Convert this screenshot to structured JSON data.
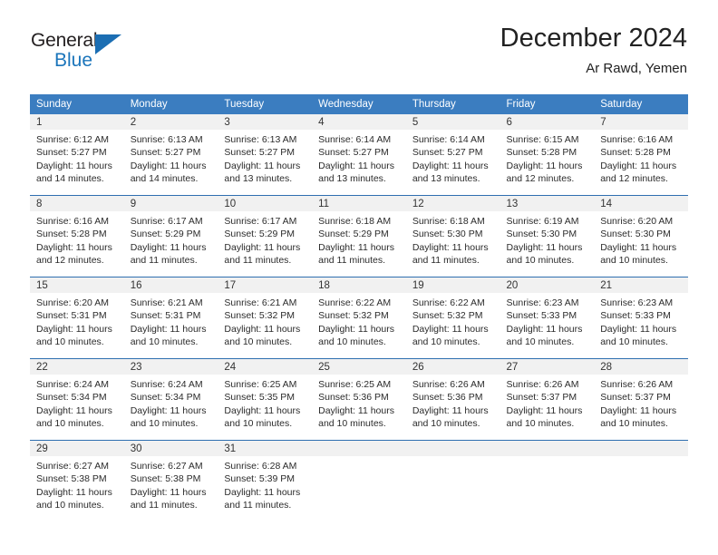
{
  "brand": {
    "name_part1": "General",
    "name_part2": "Blue",
    "flag_icon": "triangle-flag-icon"
  },
  "header": {
    "title": "December 2024",
    "subtitle": "Ar Rawd, Yemen"
  },
  "colors": {
    "header_blue": "#3b7dc0",
    "separator_blue": "#2f6fb0",
    "daynum_band": "#f1f1f1",
    "brand_blue": "#1b75bb",
    "text": "#2b2b2b"
  },
  "weekday_headers": [
    "Sunday",
    "Monday",
    "Tuesday",
    "Wednesday",
    "Thursday",
    "Friday",
    "Saturday"
  ],
  "labels": {
    "sunrise_prefix": "Sunrise:",
    "sunset_prefix": "Sunset:",
    "daylight_prefix": "Daylight:"
  },
  "weeks": [
    [
      {
        "day": "1",
        "sunrise": "Sunrise: 6:12 AM",
        "sunset": "Sunset: 5:27 PM",
        "daylight1": "Daylight: 11 hours",
        "daylight2": "and 14 minutes."
      },
      {
        "day": "2",
        "sunrise": "Sunrise: 6:13 AM",
        "sunset": "Sunset: 5:27 PM",
        "daylight1": "Daylight: 11 hours",
        "daylight2": "and 14 minutes."
      },
      {
        "day": "3",
        "sunrise": "Sunrise: 6:13 AM",
        "sunset": "Sunset: 5:27 PM",
        "daylight1": "Daylight: 11 hours",
        "daylight2": "and 13 minutes."
      },
      {
        "day": "4",
        "sunrise": "Sunrise: 6:14 AM",
        "sunset": "Sunset: 5:27 PM",
        "daylight1": "Daylight: 11 hours",
        "daylight2": "and 13 minutes."
      },
      {
        "day": "5",
        "sunrise": "Sunrise: 6:14 AM",
        "sunset": "Sunset: 5:27 PM",
        "daylight1": "Daylight: 11 hours",
        "daylight2": "and 13 minutes."
      },
      {
        "day": "6",
        "sunrise": "Sunrise: 6:15 AM",
        "sunset": "Sunset: 5:28 PM",
        "daylight1": "Daylight: 11 hours",
        "daylight2": "and 12 minutes."
      },
      {
        "day": "7",
        "sunrise": "Sunrise: 6:16 AM",
        "sunset": "Sunset: 5:28 PM",
        "daylight1": "Daylight: 11 hours",
        "daylight2": "and 12 minutes."
      }
    ],
    [
      {
        "day": "8",
        "sunrise": "Sunrise: 6:16 AM",
        "sunset": "Sunset: 5:28 PM",
        "daylight1": "Daylight: 11 hours",
        "daylight2": "and 12 minutes."
      },
      {
        "day": "9",
        "sunrise": "Sunrise: 6:17 AM",
        "sunset": "Sunset: 5:29 PM",
        "daylight1": "Daylight: 11 hours",
        "daylight2": "and 11 minutes."
      },
      {
        "day": "10",
        "sunrise": "Sunrise: 6:17 AM",
        "sunset": "Sunset: 5:29 PM",
        "daylight1": "Daylight: 11 hours",
        "daylight2": "and 11 minutes."
      },
      {
        "day": "11",
        "sunrise": "Sunrise: 6:18 AM",
        "sunset": "Sunset: 5:29 PM",
        "daylight1": "Daylight: 11 hours",
        "daylight2": "and 11 minutes."
      },
      {
        "day": "12",
        "sunrise": "Sunrise: 6:18 AM",
        "sunset": "Sunset: 5:30 PM",
        "daylight1": "Daylight: 11 hours",
        "daylight2": "and 11 minutes."
      },
      {
        "day": "13",
        "sunrise": "Sunrise: 6:19 AM",
        "sunset": "Sunset: 5:30 PM",
        "daylight1": "Daylight: 11 hours",
        "daylight2": "and 10 minutes."
      },
      {
        "day": "14",
        "sunrise": "Sunrise: 6:20 AM",
        "sunset": "Sunset: 5:30 PM",
        "daylight1": "Daylight: 11 hours",
        "daylight2": "and 10 minutes."
      }
    ],
    [
      {
        "day": "15",
        "sunrise": "Sunrise: 6:20 AM",
        "sunset": "Sunset: 5:31 PM",
        "daylight1": "Daylight: 11 hours",
        "daylight2": "and 10 minutes."
      },
      {
        "day": "16",
        "sunrise": "Sunrise: 6:21 AM",
        "sunset": "Sunset: 5:31 PM",
        "daylight1": "Daylight: 11 hours",
        "daylight2": "and 10 minutes."
      },
      {
        "day": "17",
        "sunrise": "Sunrise: 6:21 AM",
        "sunset": "Sunset: 5:32 PM",
        "daylight1": "Daylight: 11 hours",
        "daylight2": "and 10 minutes."
      },
      {
        "day": "18",
        "sunrise": "Sunrise: 6:22 AM",
        "sunset": "Sunset: 5:32 PM",
        "daylight1": "Daylight: 11 hours",
        "daylight2": "and 10 minutes."
      },
      {
        "day": "19",
        "sunrise": "Sunrise: 6:22 AM",
        "sunset": "Sunset: 5:32 PM",
        "daylight1": "Daylight: 11 hours",
        "daylight2": "and 10 minutes."
      },
      {
        "day": "20",
        "sunrise": "Sunrise: 6:23 AM",
        "sunset": "Sunset: 5:33 PM",
        "daylight1": "Daylight: 11 hours",
        "daylight2": "and 10 minutes."
      },
      {
        "day": "21",
        "sunrise": "Sunrise: 6:23 AM",
        "sunset": "Sunset: 5:33 PM",
        "daylight1": "Daylight: 11 hours",
        "daylight2": "and 10 minutes."
      }
    ],
    [
      {
        "day": "22",
        "sunrise": "Sunrise: 6:24 AM",
        "sunset": "Sunset: 5:34 PM",
        "daylight1": "Daylight: 11 hours",
        "daylight2": "and 10 minutes."
      },
      {
        "day": "23",
        "sunrise": "Sunrise: 6:24 AM",
        "sunset": "Sunset: 5:34 PM",
        "daylight1": "Daylight: 11 hours",
        "daylight2": "and 10 minutes."
      },
      {
        "day": "24",
        "sunrise": "Sunrise: 6:25 AM",
        "sunset": "Sunset: 5:35 PM",
        "daylight1": "Daylight: 11 hours",
        "daylight2": "and 10 minutes."
      },
      {
        "day": "25",
        "sunrise": "Sunrise: 6:25 AM",
        "sunset": "Sunset: 5:36 PM",
        "daylight1": "Daylight: 11 hours",
        "daylight2": "and 10 minutes."
      },
      {
        "day": "26",
        "sunrise": "Sunrise: 6:26 AM",
        "sunset": "Sunset: 5:36 PM",
        "daylight1": "Daylight: 11 hours",
        "daylight2": "and 10 minutes."
      },
      {
        "day": "27",
        "sunrise": "Sunrise: 6:26 AM",
        "sunset": "Sunset: 5:37 PM",
        "daylight1": "Daylight: 11 hours",
        "daylight2": "and 10 minutes."
      },
      {
        "day": "28",
        "sunrise": "Sunrise: 6:26 AM",
        "sunset": "Sunset: 5:37 PM",
        "daylight1": "Daylight: 11 hours",
        "daylight2": "and 10 minutes."
      }
    ],
    [
      {
        "day": "29",
        "sunrise": "Sunrise: 6:27 AM",
        "sunset": "Sunset: 5:38 PM",
        "daylight1": "Daylight: 11 hours",
        "daylight2": "and 10 minutes."
      },
      {
        "day": "30",
        "sunrise": "Sunrise: 6:27 AM",
        "sunset": "Sunset: 5:38 PM",
        "daylight1": "Daylight: 11 hours",
        "daylight2": "and 11 minutes."
      },
      {
        "day": "31",
        "sunrise": "Sunrise: 6:28 AM",
        "sunset": "Sunset: 5:39 PM",
        "daylight1": "Daylight: 11 hours",
        "daylight2": "and 11 minutes."
      },
      {
        "day": "",
        "sunrise": "",
        "sunset": "",
        "daylight1": "",
        "daylight2": ""
      },
      {
        "day": "",
        "sunrise": "",
        "sunset": "",
        "daylight1": "",
        "daylight2": ""
      },
      {
        "day": "",
        "sunrise": "",
        "sunset": "",
        "daylight1": "",
        "daylight2": ""
      },
      {
        "day": "",
        "sunrise": "",
        "sunset": "",
        "daylight1": "",
        "daylight2": ""
      }
    ]
  ]
}
